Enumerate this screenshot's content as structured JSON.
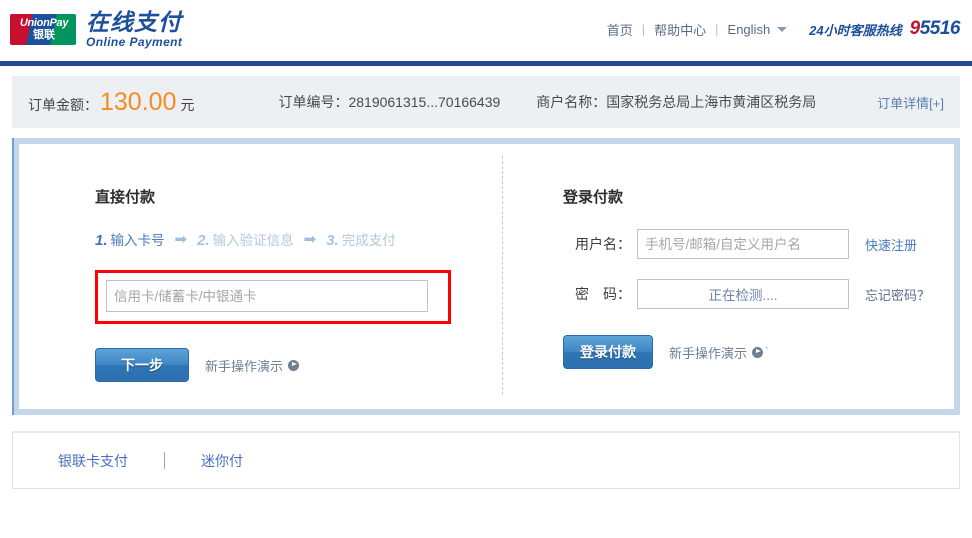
{
  "header": {
    "logo": {
      "mark_top": "UnionPay",
      "mark_bottom": "银联",
      "brand_cn": "在线支付",
      "brand_en": "Online  Payment"
    },
    "nav": {
      "home": "首页",
      "help": "帮助中心",
      "language": "English",
      "separator": "|"
    },
    "hotline": {
      "label": "24小时客服热线",
      "number_first": "9",
      "number_rest": "5516"
    }
  },
  "order": {
    "amount_label": "订单金额：",
    "amount_value": "130.00",
    "amount_unit": "元",
    "order_no": "订单编号：2819061315...70166439",
    "merchant": "商户名称：国家税务总局上海市黄浦区税务局",
    "detail_link": "订单详情[+]"
  },
  "direct_pay": {
    "title": "直接付款",
    "steps": [
      {
        "num": "1.",
        "text": "输入卡号",
        "state": "active"
      },
      {
        "num": "2.",
        "text": "输入验证信息",
        "state": "idle"
      },
      {
        "num": "3.",
        "text": "完成支付",
        "state": "idle"
      }
    ],
    "arrow": "➡",
    "card_input": {
      "value": "",
      "placeholder": "信用卡/储蓄卡/中银通卡"
    },
    "next_button": "下一步",
    "demo_link": "新手操作演示"
  },
  "login_pay": {
    "title": "登录付款",
    "username": {
      "label": "用户名：",
      "value": "",
      "placeholder": "手机号/邮箱/自定义用户名",
      "side_link": "快速注册"
    },
    "password": {
      "label": "密　码：",
      "value": "正在检测....",
      "placeholder": "",
      "side_link": "忘记密码？"
    },
    "login_button": "登录付款",
    "demo_link": "新手操作演示",
    "demo_tick": "`"
  },
  "footer": {
    "tabs": [
      {
        "label": "银联卡支付"
      },
      {
        "label": "迷你付"
      }
    ]
  },
  "colors": {
    "brand_blue": "#1c4f9c",
    "rule_blue": "#26478d",
    "amount_orange": "#f68b1f",
    "highlight_red": "#ff0000",
    "panel_border": "#c3d6ea",
    "link_blue": "#4a79bd"
  }
}
